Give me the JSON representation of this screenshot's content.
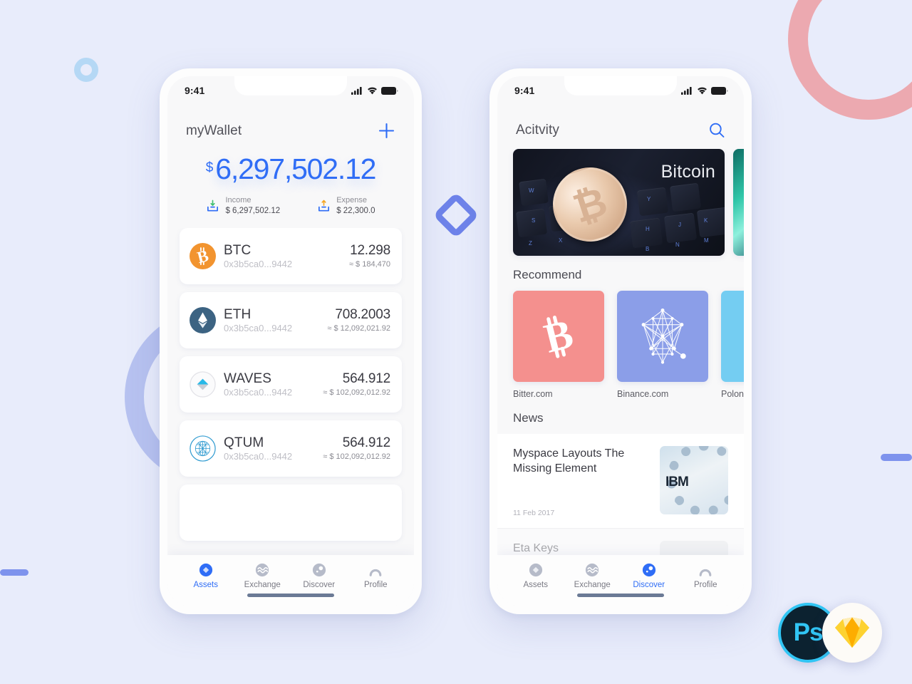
{
  "theme": {
    "background": "#e8ecfb",
    "accent": "#2f6df6",
    "ring_pink": "#eca9b0",
    "ring_periwinkle": "#b7c2f0",
    "ring_sky": "#b5d8f5",
    "bar_blue": "#7e93ed",
    "diamond_blue": "#6e83ea"
  },
  "decorations": {
    "ring_pink": "circle-outline-decoration",
    "ring_periwinkle": "circle-outline-decoration",
    "ring_sky": "small-circle-outline-decoration",
    "bar_left": "pill-bar-decoration",
    "bar_right": "pill-bar-decoration",
    "diamond": "rotated-square-outline-decoration"
  },
  "badges": [
    {
      "name": "photoshop-badge",
      "label": "Ps"
    },
    {
      "name": "sketch-badge",
      "label": ""
    }
  ],
  "wallet_screen": {
    "status_bar": {
      "time": "9:41",
      "icons": [
        "cellular-signal-icon",
        "wifi-icon",
        "battery-icon"
      ]
    },
    "header": {
      "title": "myWallet",
      "action_icon": "plus-icon"
    },
    "balance": {
      "currency_symbol": "$",
      "amount": "6,297,502.12"
    },
    "flows": [
      {
        "icon": "income-arrow-down-icon",
        "label": "Income",
        "value": "$ 6,297,502.12",
        "arrow_color": "#3fbf6f"
      },
      {
        "icon": "expense-arrow-up-icon",
        "label": "Expense",
        "value": "$ 22,300.0",
        "arrow_color": "#f5a623"
      }
    ],
    "assets": [
      {
        "icon": "btc-coin-icon",
        "symbol": "BTC",
        "address": "0x3b5ca0...9442",
        "amount": "12.298",
        "usd": "≈ $ 184,470",
        "color": "#f7931a"
      },
      {
        "icon": "eth-coin-icon",
        "symbol": "ETH",
        "address": "0x3b5ca0...9442",
        "amount": "708.2003",
        "usd": "≈ $ 12,092,021.92",
        "color": "#3c6382"
      },
      {
        "icon": "waves-coin-icon",
        "symbol": "WAVES",
        "address": "0x3b5ca0...9442",
        "amount": "564.912",
        "usd": "≈ $ 102,092,012.92",
        "color": "#28b9e8"
      },
      {
        "icon": "qtum-coin-icon",
        "symbol": "QTUM",
        "address": "0x3b5ca0...9442",
        "amount": "564.912",
        "usd": "≈ $ 102,092,012.92",
        "color": "#2e9ad0"
      }
    ],
    "tabs": [
      {
        "icon": "assets-diamond-icon",
        "label": "Assets",
        "active": true
      },
      {
        "icon": "exchange-waves-icon",
        "label": "Exchange",
        "active": false
      },
      {
        "icon": "discover-compass-icon",
        "label": "Discover",
        "active": false
      },
      {
        "icon": "profile-person-icon",
        "label": "Profile",
        "active": false
      }
    ]
  },
  "activity_screen": {
    "status_bar": {
      "time": "9:41",
      "icons": [
        "cellular-signal-icon",
        "wifi-icon",
        "battery-icon"
      ]
    },
    "header": {
      "title": "Acitvity",
      "action_icon": "search-icon"
    },
    "banners": [
      {
        "name": "bitcoin-keyboard-banner",
        "caption": "Bitcoin"
      },
      {
        "name": "teal-abstract-banner",
        "caption": ""
      }
    ],
    "recommend": {
      "title": "Recommend",
      "items": [
        {
          "name": "bitter-com-tile",
          "label": "Bitter.com",
          "icon": "bitcoin-b-icon",
          "color": "#f4908e"
        },
        {
          "name": "binance-com-tile",
          "label": "Binance.com",
          "icon": "network-polyhedron-icon",
          "color": "#8b9ee8"
        },
        {
          "name": "poloniex-tile",
          "label": "Polone",
          "icon": "",
          "color": "#74cdf2"
        }
      ]
    },
    "news": {
      "title": "News",
      "items": [
        {
          "title": "Myspace Layouts The Missing Element",
          "date": "11 Feb 2017",
          "thumb": "ibm-server-thumbnail",
          "faded": false
        },
        {
          "title": "Eta Keys",
          "date": "",
          "thumb": "avatar-thumbnail",
          "faded": true
        }
      ]
    },
    "tabs": [
      {
        "icon": "assets-diamond-icon",
        "label": "Assets",
        "active": false
      },
      {
        "icon": "exchange-waves-icon",
        "label": "Exchange",
        "active": false
      },
      {
        "icon": "discover-compass-icon",
        "label": "Discover",
        "active": true
      },
      {
        "icon": "profile-person-icon",
        "label": "Profile",
        "active": false
      }
    ]
  }
}
